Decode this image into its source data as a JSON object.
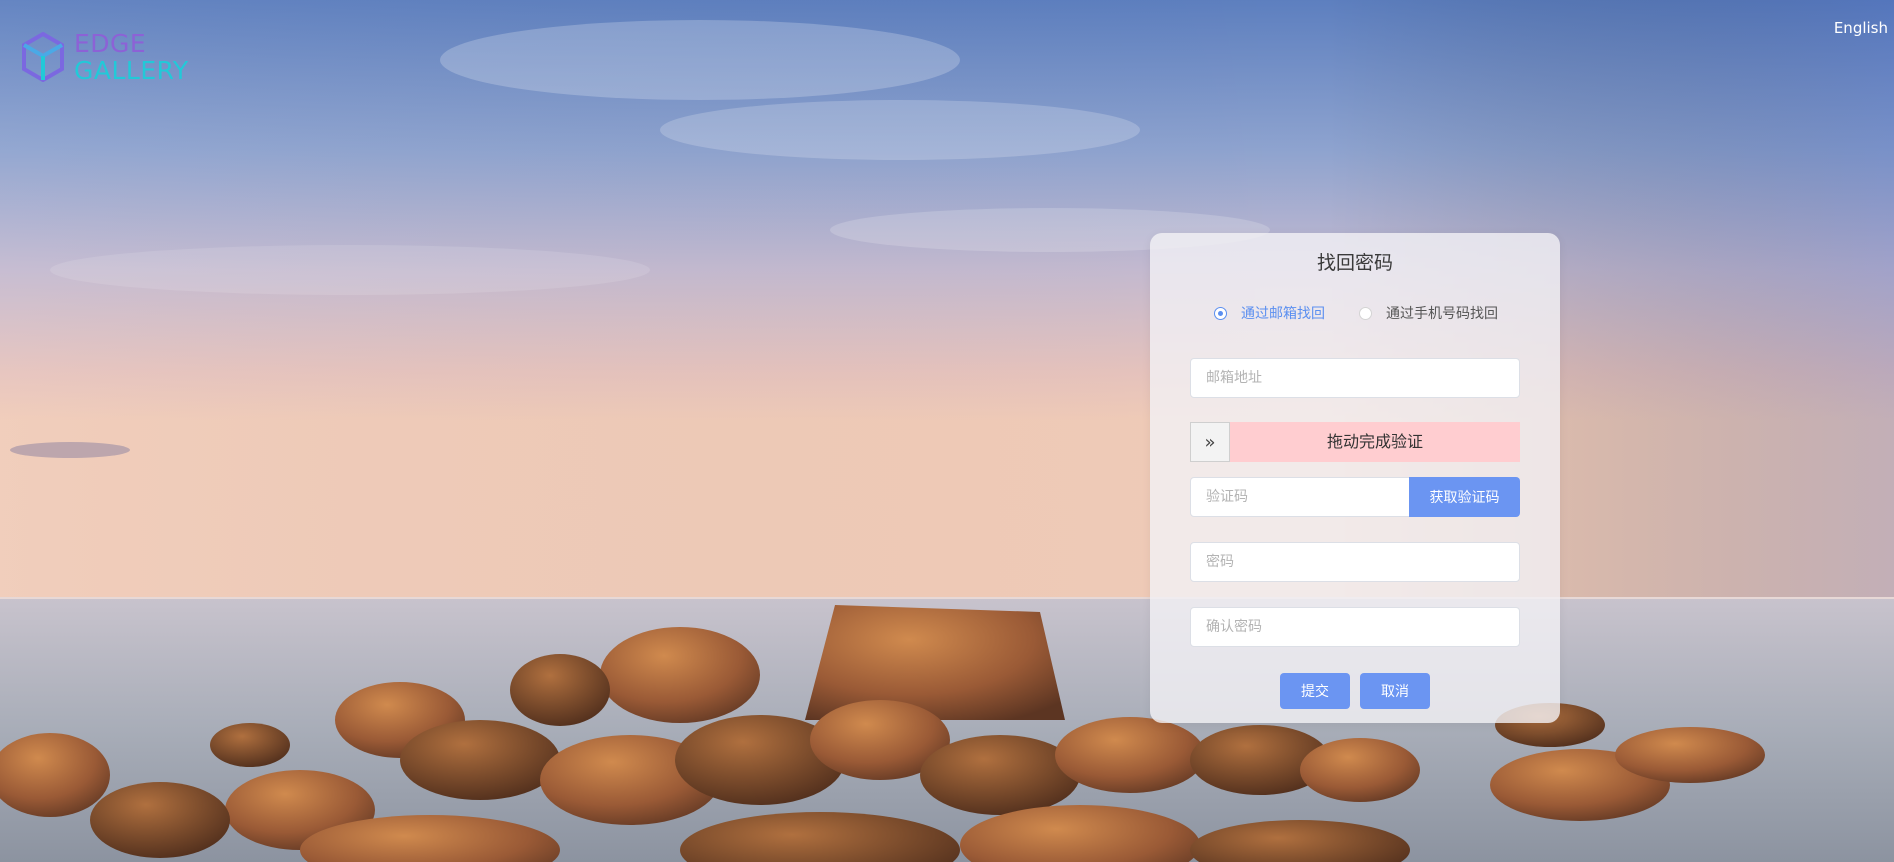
{
  "brand": {
    "line1": "EDGE",
    "line2": "GALLERY"
  },
  "header": {
    "language_label": "English"
  },
  "form": {
    "title": "找回密码",
    "radio_options": [
      {
        "label": "通过邮箱找回",
        "selected": true
      },
      {
        "label": "通过手机号码找回",
        "selected": false
      }
    ],
    "email": {
      "placeholder": "邮箱地址",
      "value": ""
    },
    "slider": {
      "handle_icon": "»",
      "text": "拖动完成验证"
    },
    "code": {
      "placeholder": "验证码",
      "value": ""
    },
    "get_code_label": "获取验证码",
    "password": {
      "placeholder": "密码",
      "value": ""
    },
    "confirm_password": {
      "placeholder": "确认密码",
      "value": ""
    },
    "submit_label": "提交",
    "cancel_label": "取消"
  },
  "colors": {
    "primary": "#6b95f2",
    "radio_active": "#5b8ff0",
    "slider_bg": "#ffcdd0",
    "brand_purple": "#8c62d6",
    "brand_cyan": "#22c9d8"
  }
}
